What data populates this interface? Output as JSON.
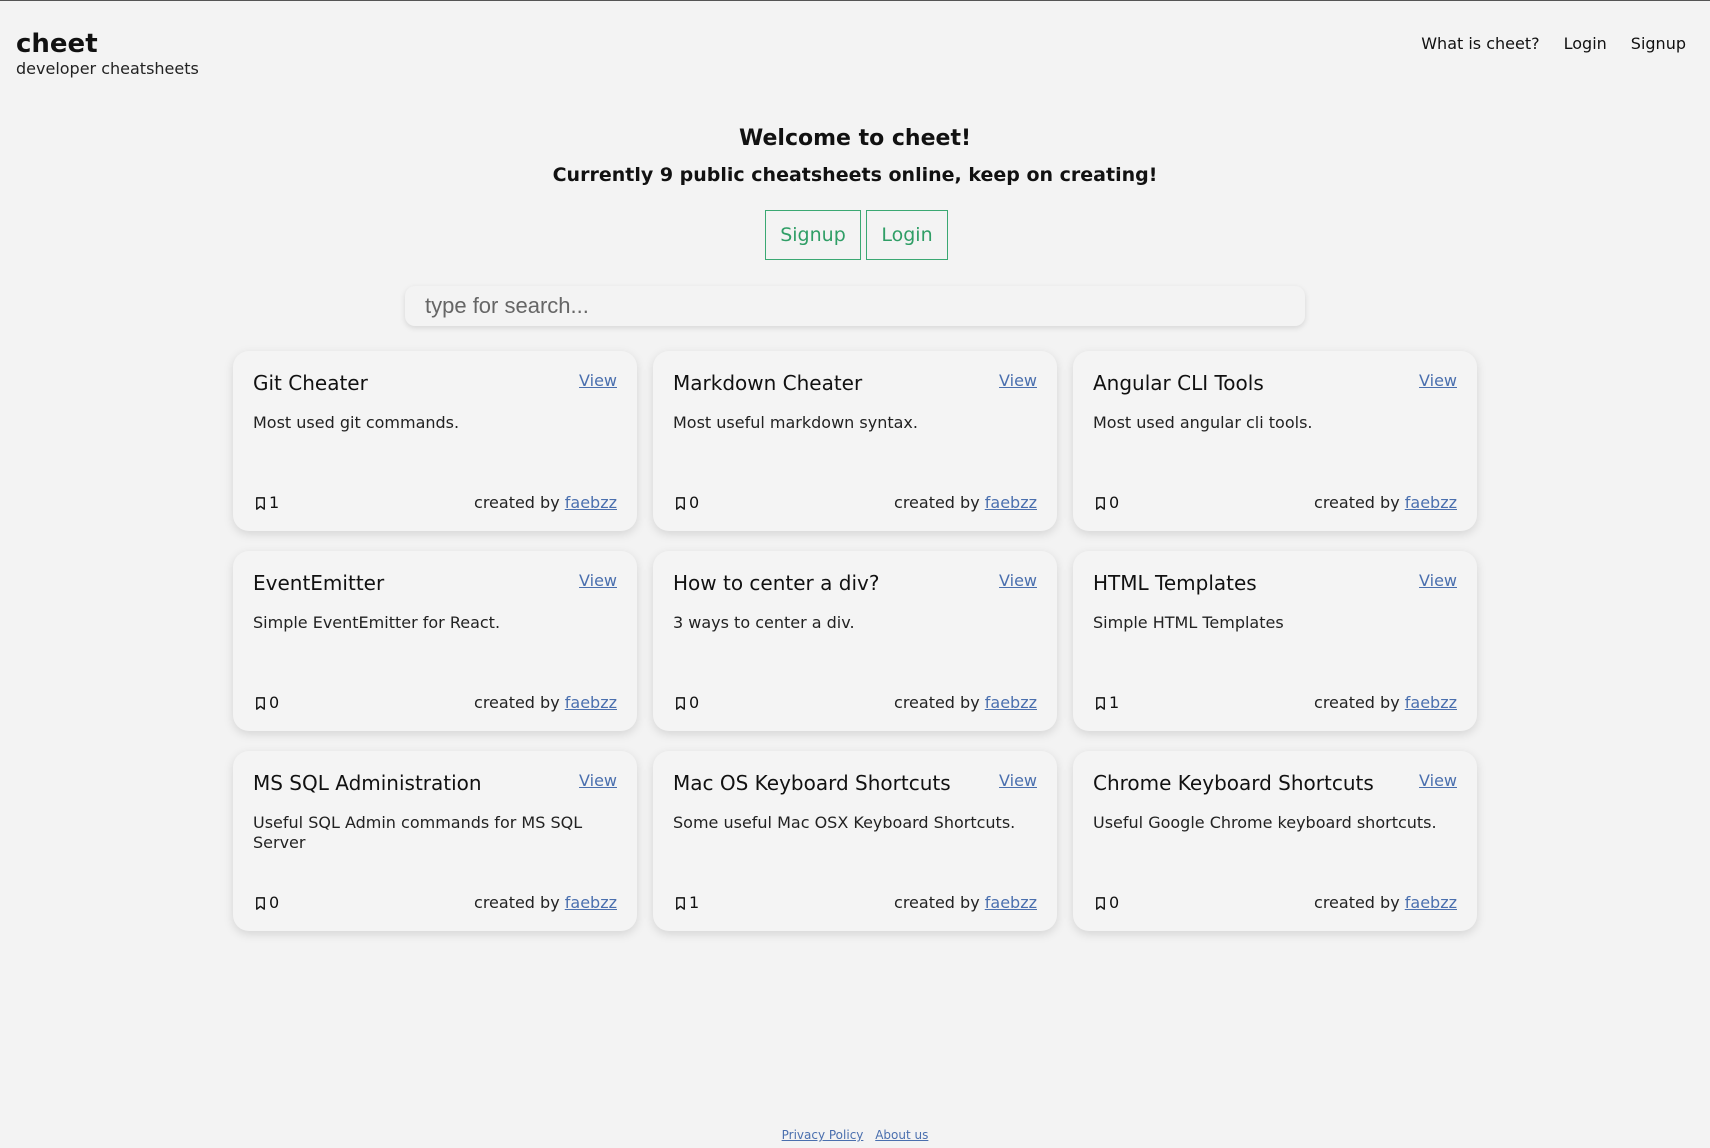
{
  "brand": {
    "name": "cheet",
    "tagline": "developer cheatsheets"
  },
  "nav": {
    "items": [
      "What is cheet?",
      "Login",
      "Signup"
    ]
  },
  "hero": {
    "title": "Welcome to cheet!",
    "subtitle": "Currently 9 public cheatsheets online, keep on creating!",
    "signup_label": "Signup",
    "login_label": "Login"
  },
  "search": {
    "placeholder": "type for search..."
  },
  "card_common": {
    "view_label": "View",
    "created_by_label": "created by",
    "bookmark_icon": "bookmark-icon"
  },
  "cards": [
    {
      "title": "Git Cheater",
      "description": "Most used git commands.",
      "bookmarks": "1",
      "author": "faebzz"
    },
    {
      "title": "Markdown Cheater",
      "description": "Most useful markdown syntax.",
      "bookmarks": "0",
      "author": "faebzz"
    },
    {
      "title": "Angular CLI Tools",
      "description": "Most used angular cli tools.",
      "bookmarks": "0",
      "author": "faebzz"
    },
    {
      "title": "EventEmitter",
      "description": "Simple EventEmitter for React.",
      "bookmarks": "0",
      "author": "faebzz"
    },
    {
      "title": "How to center a div?",
      "description": "3 ways to center a div.",
      "bookmarks": "0",
      "author": "faebzz"
    },
    {
      "title": "HTML Templates",
      "description": "Simple HTML Templates",
      "bookmarks": "1",
      "author": "faebzz"
    },
    {
      "title": "MS SQL Administration",
      "description": "Useful SQL Admin commands for MS SQL Server",
      "bookmarks": "0",
      "author": "faebzz"
    },
    {
      "title": "Mac OS Keyboard Shortcuts",
      "description": "Some useful Mac OSX Keyboard Shortcuts.",
      "bookmarks": "1",
      "author": "faebzz"
    },
    {
      "title": "Chrome Keyboard Shortcuts",
      "description": "Useful Google Chrome keyboard shortcuts.",
      "bookmarks": "0",
      "author": "faebzz"
    }
  ],
  "footer": {
    "privacy_label": "Privacy Policy",
    "about_label": "About us"
  },
  "colors": {
    "accent_green": "#3aa872",
    "link_blue": "#4a6fae",
    "background": "#f3f3f3"
  }
}
